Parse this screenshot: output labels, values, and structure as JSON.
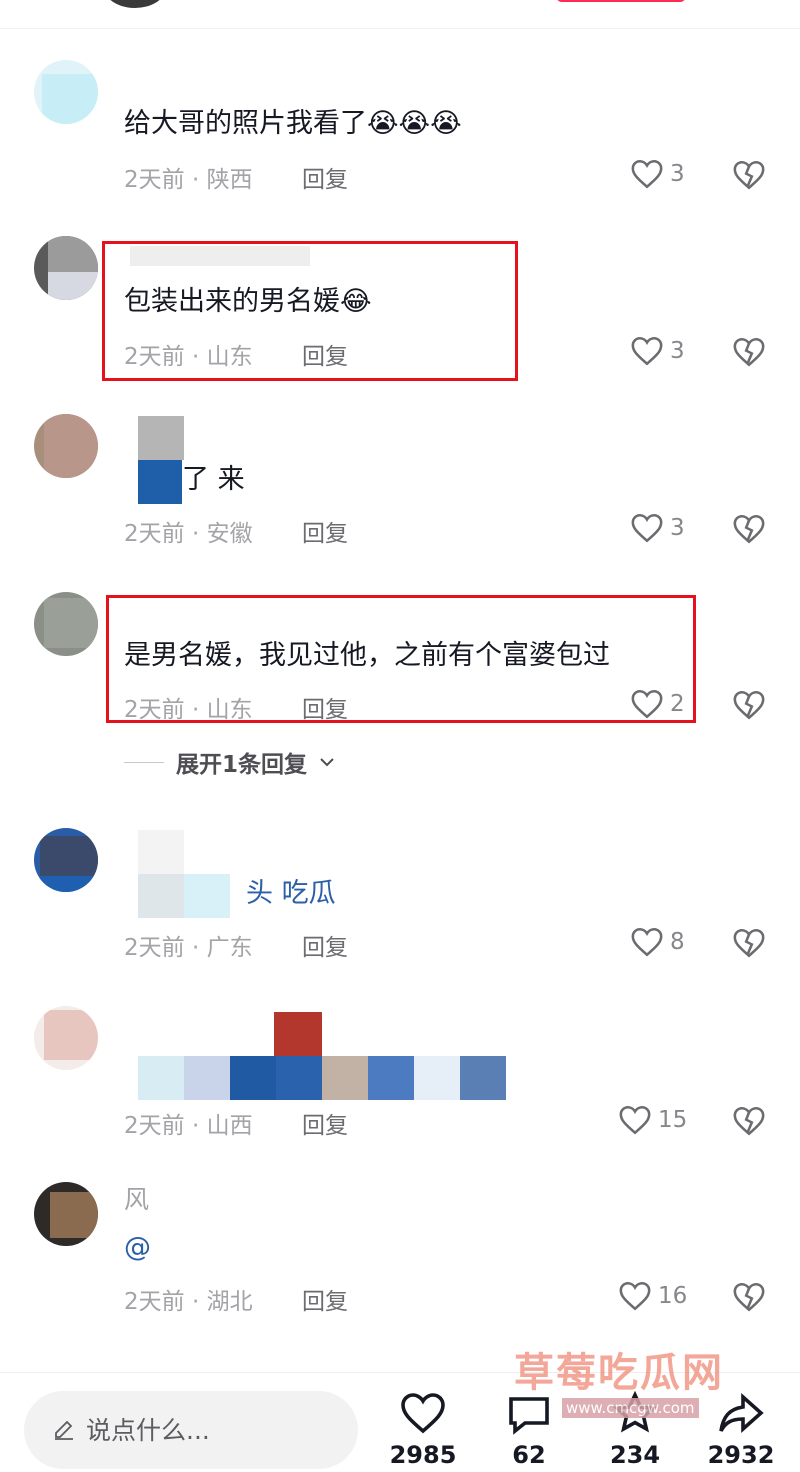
{
  "comments": [
    {
      "text": "给大哥的照片我看了",
      "emoji": "😭😭😭",
      "time": "2天前",
      "sep": "·",
      "location": "陕西",
      "reply": "回复",
      "likes": "3"
    },
    {
      "text": "包装出来的男名媛",
      "emoji": "😂",
      "time": "2天前",
      "sep": "·",
      "location": "山东",
      "reply": "回复",
      "likes": "3"
    },
    {
      "text": "了 来",
      "time": "2天前",
      "sep": "·",
      "location": "安徽",
      "reply": "回复",
      "likes": "3"
    },
    {
      "text": "是男名媛，我见过他，之前有个富婆包过",
      "time": "2天前",
      "sep": "·",
      "location": "山东",
      "reply": "回复",
      "likes": "2"
    },
    {
      "text": "头 吃瓜",
      "time": "2天前",
      "sep": "·",
      "location": "广东",
      "reply": "回复",
      "likes": "8"
    },
    {
      "text": "",
      "time": "2天前",
      "sep": "·",
      "location": "山西",
      "reply": "回复",
      "likes": "15"
    },
    {
      "name_fragment": "风",
      "text": "@",
      "time": "2天前",
      "sep": "·",
      "location": "湖北",
      "reply": "回复",
      "likes": "16"
    }
  ],
  "expand_replies": "展开1条回复",
  "bottom": {
    "input_placeholder": "说点什么...",
    "likes": "2985",
    "comments": "62",
    "favorites": "234",
    "shares": "2932"
  },
  "watermark": {
    "title": "草莓吃瓜网",
    "url": "www.cmcgw.com"
  },
  "colors": {
    "highlight_box": "#e4121c",
    "meta_text": "#a3a3a8",
    "accent": "#fe2c55"
  },
  "icons": [
    "heart-icon",
    "broken-heart-icon",
    "pen-icon",
    "comment-icon",
    "star-icon",
    "share-icon",
    "chevron-down-icon"
  ]
}
